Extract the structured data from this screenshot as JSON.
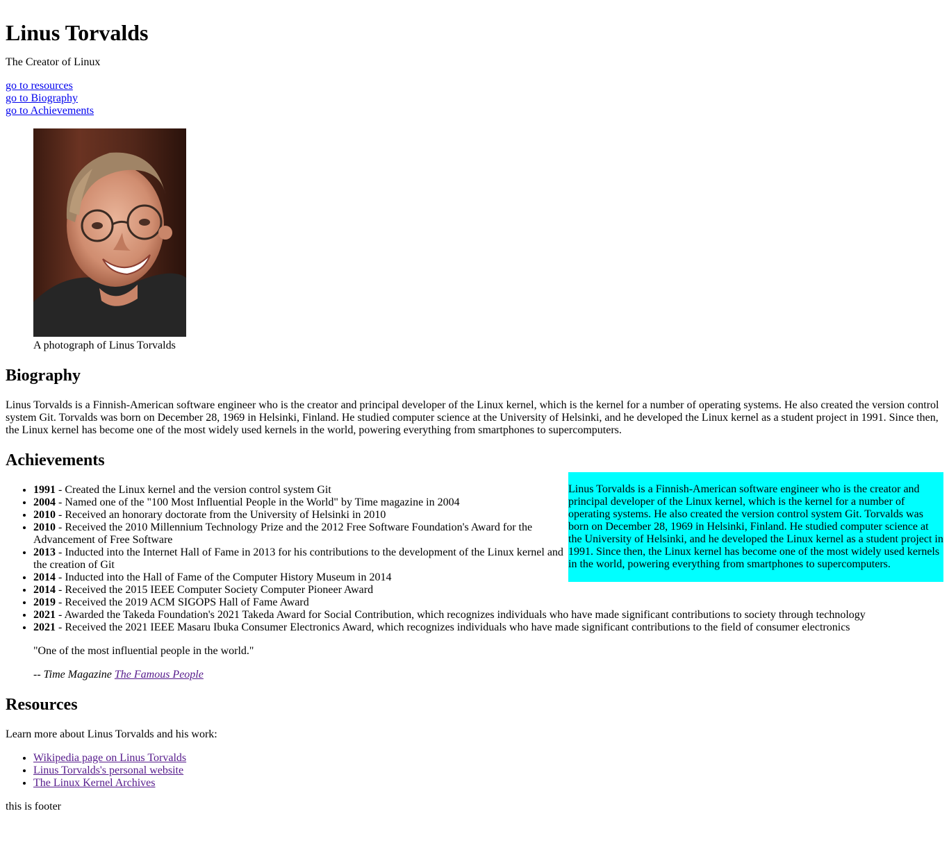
{
  "header": {
    "title": "Linus Torvalds",
    "subtitle": "The Creator of Linux"
  },
  "nav": {
    "links": [
      "go to resources",
      "go to Biography",
      "go to Achievements"
    ]
  },
  "figure": {
    "caption": "A photograph of Linus Torvalds"
  },
  "biography": {
    "heading": "Biography",
    "text": "Linus Torvalds is a Finnish-American software engineer who is the creator and principal developer of the Linux kernel, which is the kernel for a number of operating systems. He also created the version control system Git. Torvalds was born on December 28, 1969 in Helsinki, Finland. He studied computer science at the University of Helsinki, and he developed the Linux kernel as a student project in 1991. Since then, the Linux kernel has become one of the most widely used kernels in the world, powering everything from smartphones to supercomputers."
  },
  "aside": {
    "text": "Linus Torvalds is a Finnish-American software engineer who is the creator and principal developer of the Linux kernel, which is the kernel for a number of operating systems. He also created the version control system Git. Torvalds was born on December 28, 1969 in Helsinki, Finland. He studied computer science at the University of Helsinki, and he developed the Linux kernel as a student project in 1991. Since then, the Linux kernel has become one of the most widely used kernels in the world, powering everything from smartphones to supercomputers.",
    "background": "#00ffff"
  },
  "achievements": {
    "heading": "Achievements",
    "items": [
      {
        "year": "1991",
        "text": " - Created the Linux kernel and the version control system Git"
      },
      {
        "year": "2004",
        "text": " - Named one of the \"100 Most Influential People in the World\" by Time magazine in 2004"
      },
      {
        "year": "2010",
        "text": " - Received an honorary doctorate from the University of Helsinki in 2010"
      },
      {
        "year": "2010",
        "text": " - Received the 2010 Millennium Technology Prize and the 2012 Free Software Foundation's Award for the Advancement of Free Software"
      },
      {
        "year": "2013",
        "text": " - Inducted into the Internet Hall of Fame in 2013 for his contributions to the development of the Linux kernel and the creation of Git"
      },
      {
        "year": "2014",
        "text": " - Inducted into the Hall of Fame of the Computer History Museum in 2014"
      },
      {
        "year": "2014",
        "text": " - Received the 2015 IEEE Computer Society Computer Pioneer Award"
      },
      {
        "year": "2019",
        "text": " - Received the 2019 ACM SIGOPS Hall of Fame Award"
      },
      {
        "year": "2021",
        "text": " - Awarded the Takeda Foundation's 2021 Takeda Award for Social Contribution, which recognizes individuals who have made significant contributions to society through technology"
      },
      {
        "year": "2021",
        "text": " - Received the 2021 IEEE Masaru Ibuka Consumer Electronics Award, which recognizes individuals who have made significant contributions to the field of consumer electronics"
      }
    ]
  },
  "quote": {
    "text": "\"One of the most influential people in the world.\"",
    "cite_prefix": "-- Time Magazine ",
    "cite_link": "The Famous People"
  },
  "resources": {
    "heading": "Resources",
    "intro": "Learn more about Linus Torvalds and his work:",
    "links": [
      "Wikipedia page on Linus Torvalds",
      "Linus Torvalds's personal website",
      "The Linux Kernel Archives"
    ]
  },
  "footer": {
    "text": "this is footer"
  },
  "colors": {
    "link": "#0000ee",
    "visited_link": "#551a8b",
    "aside_background": "#00ffff"
  }
}
